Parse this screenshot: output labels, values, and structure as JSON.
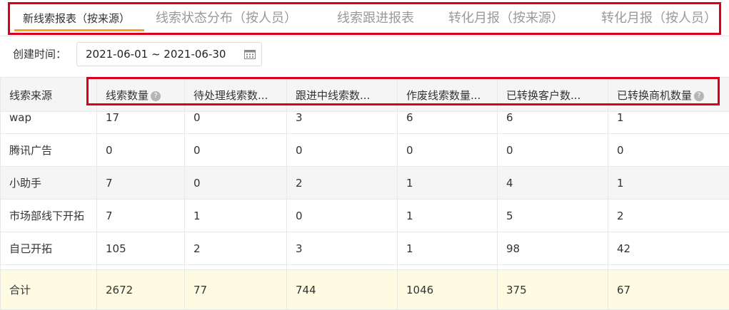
{
  "tabs": [
    {
      "label": "新线索报表（按来源）",
      "active": true
    },
    {
      "label": "线索状态分布（按人员）",
      "active": false
    },
    {
      "label": "线索跟进报表",
      "active": false
    },
    {
      "label": "转化月报（按来源）",
      "active": false
    },
    {
      "label": "转化月报（按人员）",
      "active": false
    }
  ],
  "filter": {
    "label": "创建时间：",
    "date_range": "2021-06-01 ~ 2021-06-30",
    "icon": "calendar-icon"
  },
  "table": {
    "columns": [
      {
        "label": "线索来源",
        "help": false
      },
      {
        "label": "线索数量",
        "help": true
      },
      {
        "label": "待处理线索数...",
        "help": false
      },
      {
        "label": "跟进中线索数...",
        "help": false
      },
      {
        "label": "作废线索数量...",
        "help": false
      },
      {
        "label": "已转换客户数...",
        "help": false
      },
      {
        "label": "已转换商机数量",
        "help": true
      }
    ],
    "rows": [
      [
        "wap",
        "17",
        "0",
        "3",
        "6",
        "6",
        "1"
      ],
      [
        "腾讯广告",
        "0",
        "0",
        "0",
        "0",
        "0",
        "0"
      ],
      [
        "小助手",
        "7",
        "0",
        "2",
        "1",
        "4",
        "1"
      ],
      [
        "市场部线下开拓",
        "7",
        "1",
        "0",
        "1",
        "5",
        "2"
      ],
      [
        "自己开拓",
        "105",
        "2",
        "3",
        "1",
        "98",
        "42"
      ]
    ],
    "total": [
      "合计",
      "2672",
      "77",
      "744",
      "1046",
      "375",
      "67"
    ]
  },
  "colors": {
    "accent": "#ff9f1a",
    "highlight_border": "#d6001c",
    "header_bg": "#f5f5f5",
    "total_bg": "#fdfbe2"
  }
}
